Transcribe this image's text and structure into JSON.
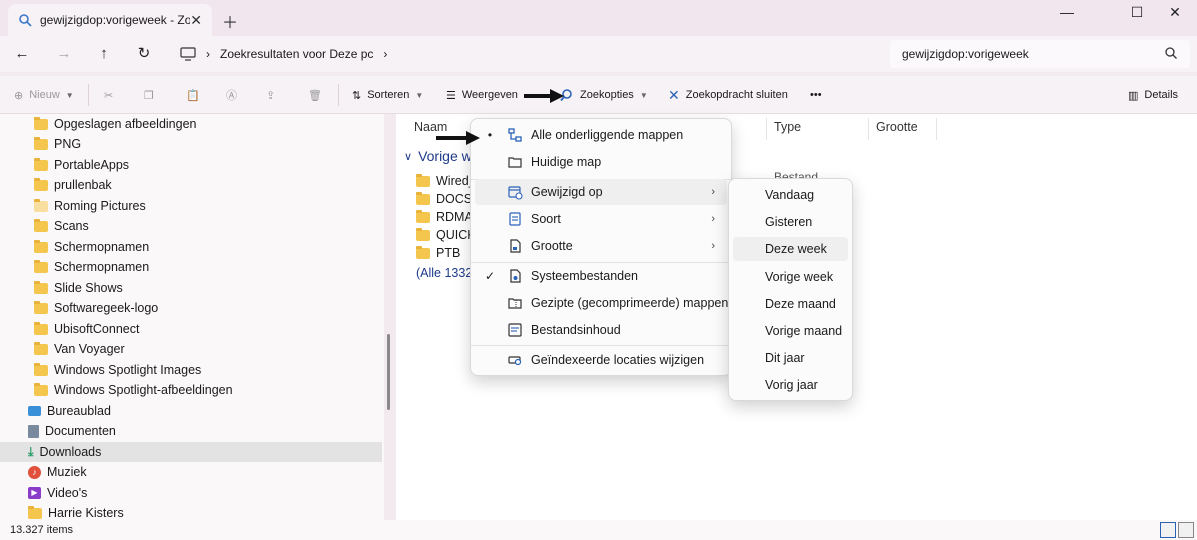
{
  "tab": {
    "title": "gewijzigdop:vorigeweek - Zoe"
  },
  "address": {
    "breadcrumb": "Zoekresultaten voor Deze pc"
  },
  "search": {
    "value": "gewijzigdop:vorigeweek"
  },
  "toolbar": {
    "new_label": "Nieuw",
    "sort_label": "Sorteren",
    "view_label": "Weergeven",
    "search_options_label": "Zoekopties",
    "close_search_label": "Zoekopdracht sluiten",
    "more_label": "•••",
    "details_label": "Details"
  },
  "sidebar": {
    "items": [
      {
        "label": "Opgeslagen afbeeldingen",
        "icon": "folder-icon"
      },
      {
        "label": "PNG",
        "icon": "folder-icon"
      },
      {
        "label": "PortableApps",
        "icon": "folder-icon"
      },
      {
        "label": "prullenbak",
        "icon": "folder-icon"
      },
      {
        "label": "Roming Pictures",
        "icon": "folder-icon"
      },
      {
        "label": "Scans",
        "icon": "folder-icon"
      },
      {
        "label": "Schermopnamen",
        "icon": "folder-icon"
      },
      {
        "label": "Schermopnamen",
        "icon": "folder-icon"
      },
      {
        "label": "Slide Shows",
        "icon": "folder-icon"
      },
      {
        "label": "Softwaregeek-logo",
        "icon": "folder-icon"
      },
      {
        "label": "UbisoftConnect",
        "icon": "folder-icon"
      },
      {
        "label": "Van Voyager",
        "icon": "folder-icon"
      },
      {
        "label": "Windows Spotlight Images",
        "icon": "folder-icon"
      },
      {
        "label": "Windows Spotlight-afbeeldingen",
        "icon": "folder-icon"
      },
      {
        "label": "Bureaublad",
        "icon": "desktop-icon"
      },
      {
        "label": "Documenten",
        "icon": "documents-icon"
      },
      {
        "label": "Downloads",
        "icon": "downloads-icon"
      },
      {
        "label": "Muziek",
        "icon": "music-icon"
      },
      {
        "label": "Video's",
        "icon": "video-icon"
      },
      {
        "label": "Harrie Kisters",
        "icon": "folder-icon"
      }
    ]
  },
  "content": {
    "columns": {
      "name": "Naam",
      "type": "Type",
      "size": "Grootte"
    },
    "group_label": "Vorige w",
    "files": [
      "Wired_",
      "DOCS",
      "RDMA",
      "QUICK",
      "PTB"
    ],
    "more_label": "(Alle 1332",
    "partial_type": "Bestand"
  },
  "menu": {
    "items": [
      {
        "label": "Alle onderliggende mappen",
        "mark": "•"
      },
      {
        "label": "Huidige map",
        "mark": ""
      },
      {
        "label": "Gewijzigd op",
        "mark": "",
        "arrow": "›"
      },
      {
        "label": "Soort",
        "mark": "",
        "arrow": "›"
      },
      {
        "label": "Grootte",
        "mark": "",
        "arrow": "›"
      },
      {
        "label": "Systeembestanden",
        "mark": "✓"
      },
      {
        "label": "Gezipte (gecomprimeerde) mappen",
        "mark": ""
      },
      {
        "label": "Bestandsinhoud",
        "mark": ""
      },
      {
        "label": "Geïndexeerde locaties wijzigen",
        "mark": ""
      }
    ]
  },
  "submenu": {
    "items": [
      "Vandaag",
      "Gisteren",
      "Deze week",
      "Vorige week",
      "Deze maand",
      "Vorige maand",
      "Dit jaar",
      "Vorig jaar"
    ]
  },
  "status": {
    "count": "13.327 items"
  },
  "colors": {
    "folder": "#f4c64d",
    "accent": "#1f3a8a",
    "download": "#2e9e6a",
    "music": "#e0503c",
    "video": "#8a3cc9"
  }
}
